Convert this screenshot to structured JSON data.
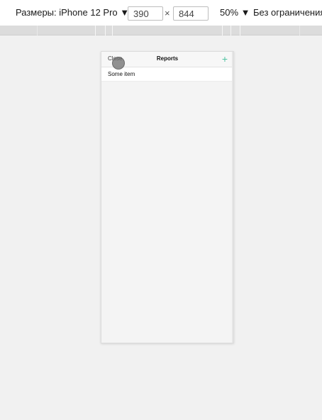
{
  "toolbar": {
    "device_label": "Размеры: iPhone 12 Pro ▼",
    "width_value": "390",
    "times": "×",
    "height_value": "844",
    "zoom_label": "50% ▼",
    "throttle_label": "Без ограничения"
  },
  "app": {
    "nav": {
      "close_label": "Close",
      "title": "Reports",
      "add_label": "+"
    },
    "items": [
      "Some item"
    ],
    "accent_color": "#4fc3a1"
  }
}
